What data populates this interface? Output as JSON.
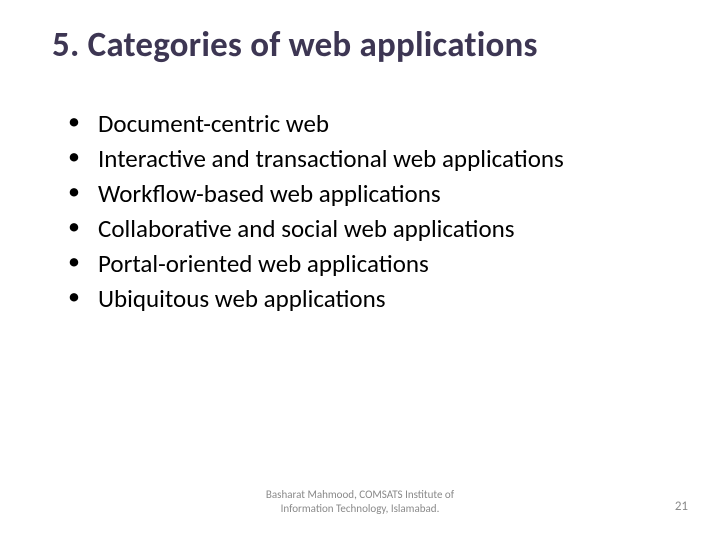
{
  "title": "5. Categories of web applications",
  "bullets": [
    "Document-centric web",
    "Interactive and transactional web applications",
    "Workflow-based web applications",
    "Collaborative and social web applications",
    "Portal-oriented web applications",
    "Ubiquitous web applications"
  ],
  "footer": {
    "line1": "Basharat Mahmood, COMSATS Institute of",
    "line2": "Information Technology, Islamabad."
  },
  "page_number": "21"
}
